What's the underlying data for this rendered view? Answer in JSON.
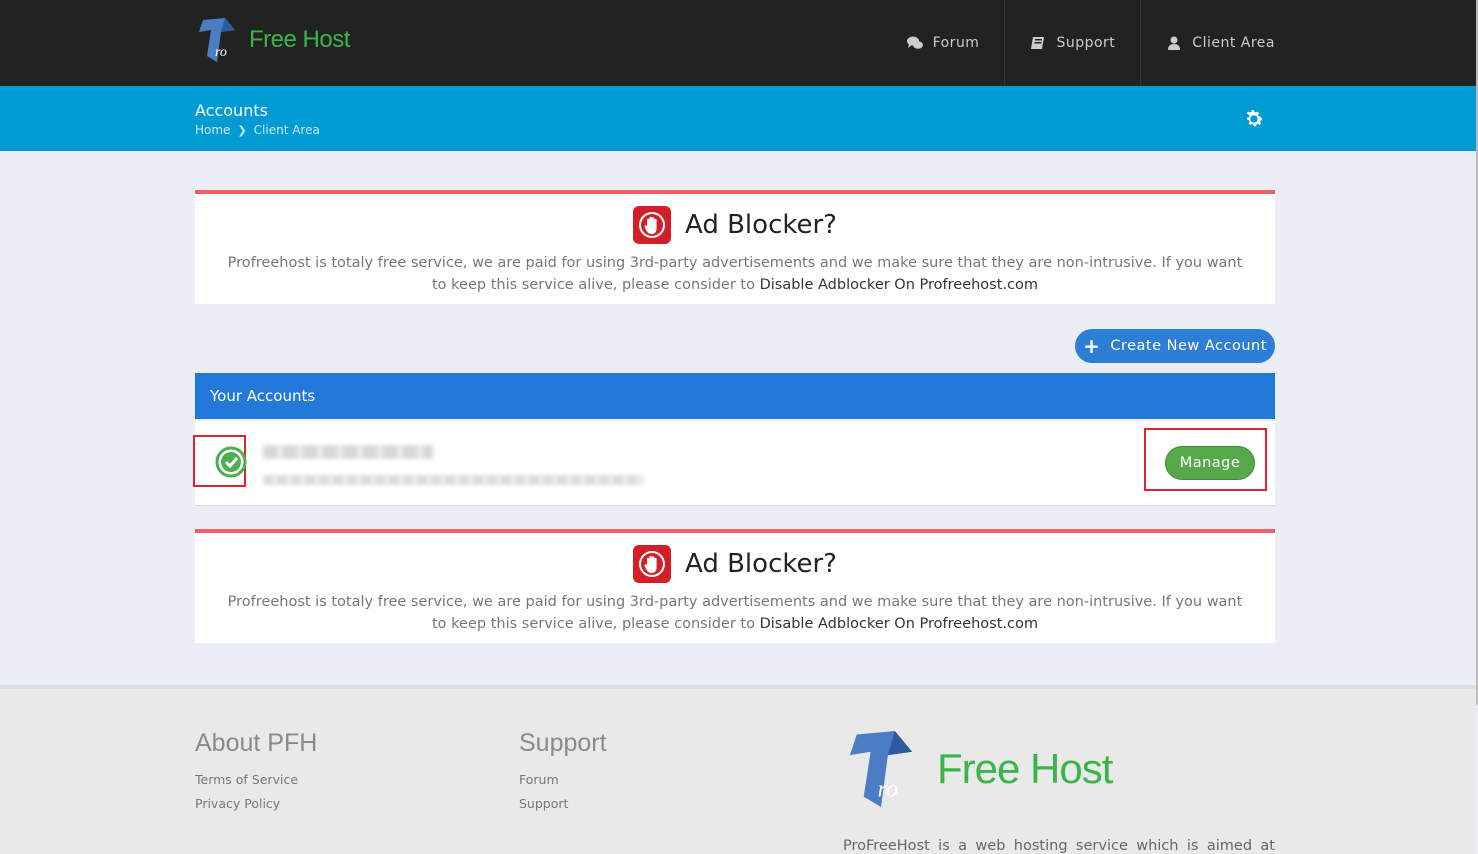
{
  "header": {
    "logo_text": "Free Host",
    "nav": [
      {
        "label": "Forum",
        "icon": "comments-icon"
      },
      {
        "label": "Support",
        "icon": "book-icon"
      },
      {
        "label": "Client Area",
        "icon": "user-icon"
      }
    ]
  },
  "subheader": {
    "title": "Accounts",
    "breadcrumb": [
      "Home",
      "Client Area"
    ]
  },
  "adblock": {
    "title": "Ad Blocker?",
    "text": "Profreehost is totaly free service, we are paid for using 3rd-party advertisements and we make sure that they are non-intrusive. If you want to keep this service alive, please consider to",
    "link": "Disable Adblocker On Profreehost.com"
  },
  "actions": {
    "create_label": "Create New Account"
  },
  "accounts": {
    "header": "Your Accounts",
    "rows": [
      {
        "status": "active",
        "manage_label": "Manage"
      }
    ]
  },
  "footer": {
    "about": {
      "title": "About PFH",
      "links": [
        "Terms of Service",
        "Privacy Policy"
      ]
    },
    "support": {
      "title": "Support",
      "links": [
        "Forum",
        "Support"
      ]
    },
    "logo_text": "Free Host",
    "description": "ProFreeHost is a web hosting service which is aimed at"
  },
  "colors": {
    "brand_green": "#3bb54a",
    "subheader": "#009bd3",
    "accent_blue": "#2379d9",
    "ad_border": "#ef6063",
    "manage_green": "#56a84a"
  }
}
